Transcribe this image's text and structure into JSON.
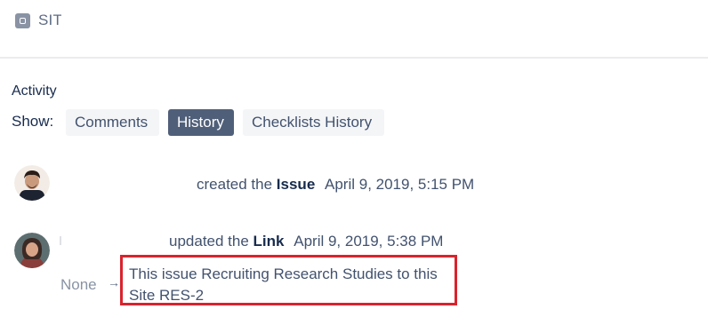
{
  "header": {
    "label": "SIT"
  },
  "activity": {
    "title": "Activity",
    "show_label": "Show:",
    "tabs": [
      {
        "label": "Comments",
        "active": false
      },
      {
        "label": "History",
        "active": true
      },
      {
        "label": "Checklists History",
        "active": false
      }
    ]
  },
  "entries": [
    {
      "action": "created the",
      "object": "Issue",
      "date": "April 9, 2019, 5:15 PM"
    },
    {
      "action": "updated the",
      "object": "Link",
      "date": "April 9, 2019, 5:38 PM",
      "old_value": "None",
      "arrow": "→",
      "new_value": "This issue Recruiting Research Studies to this Site RES-2"
    }
  ],
  "colors": {
    "highlight_border": "#d9232d",
    "active_tab": "#505f79",
    "inactive_tab": "#f4f5f7"
  }
}
